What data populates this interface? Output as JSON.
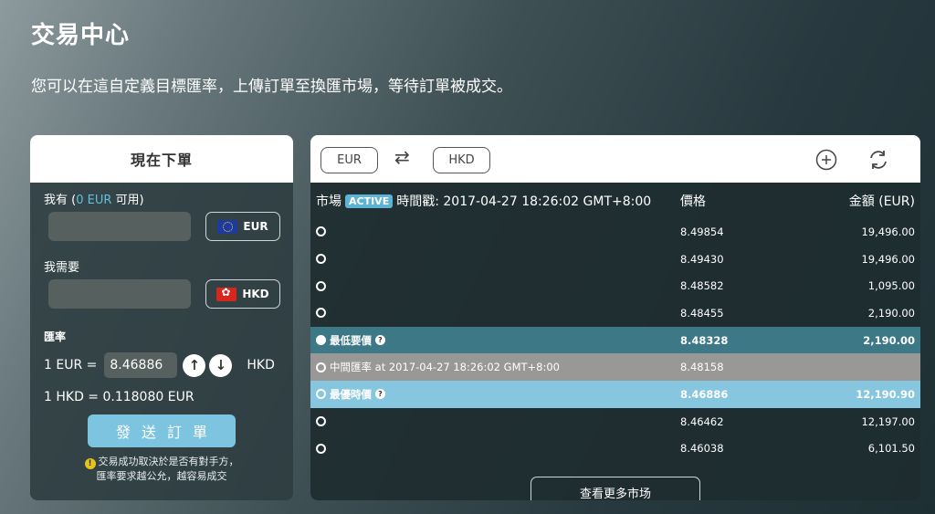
{
  "page": {
    "title": "交易中心",
    "subtitle": "您可以在這自定義目標匯率，上傳訂單至換匯市場，等待訂單被成交。"
  },
  "order": {
    "header": "現在下單",
    "have_prefix": "我有 (",
    "have_balance": "0 EUR",
    "have_suffix": " 可用)",
    "have_amount": "",
    "have_currency": "EUR",
    "need_label": "我需要",
    "need_amount": "",
    "need_currency": "HKD",
    "rate_label": "匯率",
    "rate_from": "1 EUR =",
    "rate_value": "8.46886",
    "rate_to": "HKD",
    "up_icon": "↑",
    "down_icon": "↓",
    "inverse_rate": "1 HKD = 0.118080 EUR",
    "submit_label": "發送訂單",
    "note_icon": "!",
    "note_line1": "交易成功取決於是否有對手方，",
    "note_line2": "匯率要求越公允，越容易成交"
  },
  "market": {
    "base_ccy": "EUR",
    "quote_ccy": "HKD",
    "swap_icon": "⇄",
    "head_market": "市場",
    "status": "ACTIVE",
    "timestamp": "時間戳: 2017-04-27 18:26:02 GMT+8:00",
    "col_price": "價格",
    "col_amount": "金額 (EUR)",
    "rows": [
      {
        "price": "8.49854",
        "amount": "19,496.00"
      },
      {
        "price": "8.49430",
        "amount": "19,496.00"
      },
      {
        "price": "8.48582",
        "amount": "1,095.00"
      },
      {
        "price": "8.48455",
        "amount": "2,190.00"
      },
      {
        "label": "最低要價",
        "help": "?",
        "price": "8.48328",
        "amount": "2,190.00"
      },
      {
        "label": "中間匯率 at 2017-04-27 18:26:02 GMT+8:00",
        "price": "8.48158",
        "amount": ""
      },
      {
        "label": "最優時價",
        "help": "?",
        "price": "8.46886",
        "amount": "12,190.90"
      },
      {
        "price": "8.46462",
        "amount": "12,197.00"
      },
      {
        "price": "8.46038",
        "amount": "6,101.50"
      }
    ],
    "more_label": "查看更多市场"
  },
  "icons": {
    "add": "plus-circle-icon",
    "refresh": "refresh-icon"
  }
}
